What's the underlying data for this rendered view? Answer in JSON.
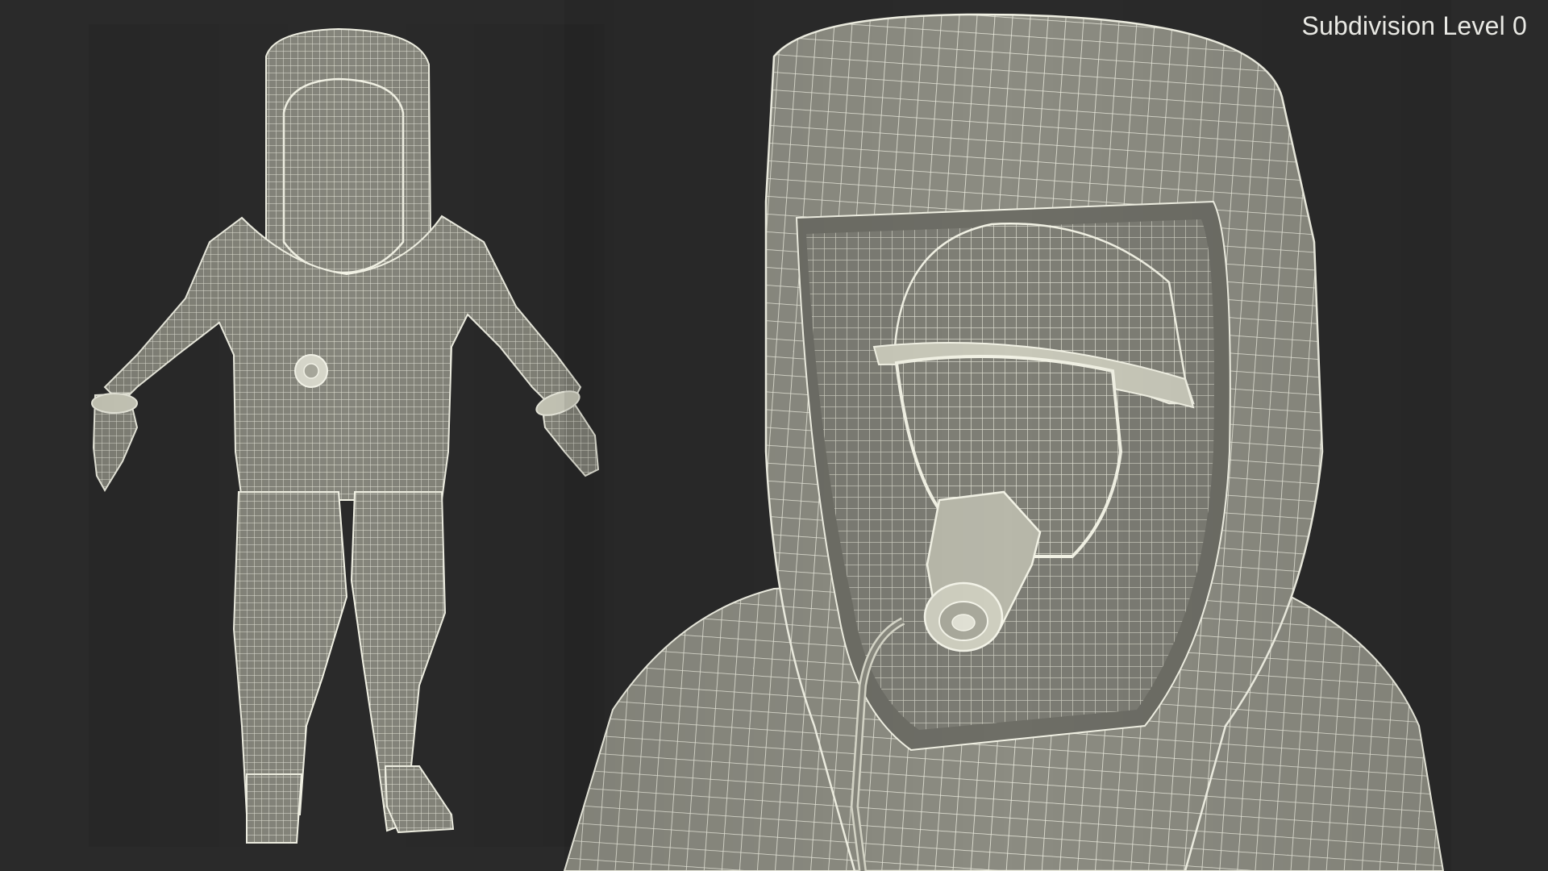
{
  "overlay": {
    "label": "Subdivision Level 0"
  },
  "views": {
    "full_body_icon": "hazmat-suit-full-body-wireframe",
    "closeup_icon": "hazmat-hood-respirator-closeup-wireframe"
  },
  "colors": {
    "background": "#2a2a2a",
    "surface": "#8a8a80",
    "surface_shadow": "#5f5f58",
    "wire": "#f4f4e8",
    "text": "#e9e9e4"
  }
}
